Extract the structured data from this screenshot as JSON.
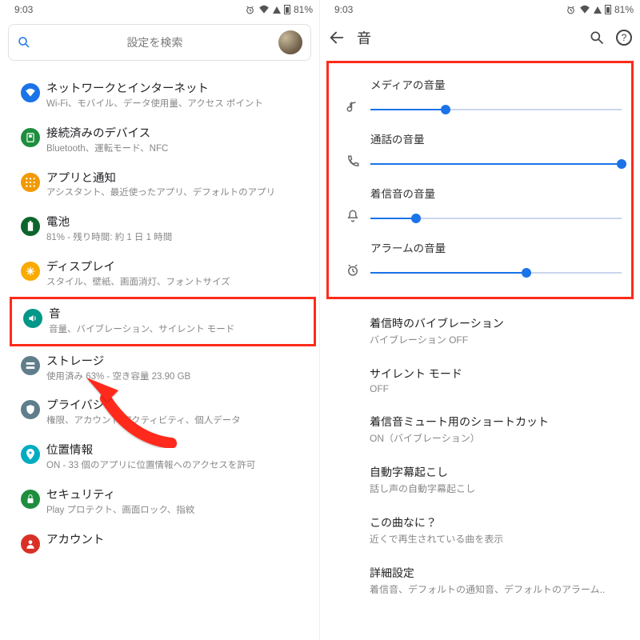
{
  "status": {
    "time": "9:03",
    "battery": "81%"
  },
  "search": {
    "placeholder": "設定を検索"
  },
  "settings": [
    {
      "title": "ネットワークとインターネット",
      "sub": "Wi-Fi、モバイル、データ使用量、アクセス ポイント",
      "color": "#1a73e8",
      "icon": "wifi"
    },
    {
      "title": "接続済みのデバイス",
      "sub": "Bluetooth、運転モード、NFC",
      "color": "#1e8e3e",
      "icon": "device"
    },
    {
      "title": "アプリと通知",
      "sub": "アシスタント、最近使ったアプリ、デフォルトのアプリ",
      "color": "#f29900",
      "icon": "grid"
    },
    {
      "title": "電池",
      "sub": "81% - 残り時間: 約 1 日 1 時間",
      "color": "#0d652d",
      "icon": "battery"
    },
    {
      "title": "ディスプレイ",
      "sub": "スタイル、壁紙、画面消灯、フォントサイズ",
      "color": "#f9ab00",
      "icon": "sun"
    },
    {
      "title": "音",
      "sub": "音量、バイブレーション、サイレント モード",
      "color": "#009688",
      "icon": "sound",
      "highlight": true
    },
    {
      "title": "ストレージ",
      "sub": "使用済み 63% - 空き容量 23.90 GB",
      "color": "#607d8b",
      "icon": "storage"
    },
    {
      "title": "プライバシー",
      "sub": "権限、アカウント アクティビティ、個人データ",
      "color": "#607d8b",
      "icon": "privacy"
    },
    {
      "title": "位置情報",
      "sub": "ON - 33 個のアプリに位置情報へのアクセスを許可",
      "color": "#00acc1",
      "icon": "location"
    },
    {
      "title": "セキュリティ",
      "sub": "Play プロテクト、画面ロック、指紋",
      "color": "#1e8e3e",
      "icon": "security"
    },
    {
      "title": "アカウント",
      "sub": "",
      "color": "#d93025",
      "icon": "account"
    }
  ],
  "sound": {
    "header": "音",
    "sliders": [
      {
        "label": "メディアの音量",
        "value": 30,
        "icon": "note"
      },
      {
        "label": "通話の音量",
        "value": 100,
        "icon": "phone"
      },
      {
        "label": "着信音の音量",
        "value": 18,
        "icon": "bell"
      },
      {
        "label": "アラームの音量",
        "value": 62,
        "icon": "alarm"
      }
    ],
    "options": [
      {
        "title": "着信時のバイブレーション",
        "sub": "バイブレーション OFF"
      },
      {
        "title": "サイレント モード",
        "sub": "OFF"
      },
      {
        "title": "着信音ミュート用のショートカット",
        "sub": "ON（バイブレーション）"
      },
      {
        "title": "自動字幕起こし",
        "sub": "話し声の自動字幕起こし"
      },
      {
        "title": "この曲なに？",
        "sub": "近くで再生されている曲を表示"
      },
      {
        "title": "詳細設定",
        "sub": "着信音、デフォルトの通知音、デフォルトのアラーム.."
      }
    ]
  }
}
